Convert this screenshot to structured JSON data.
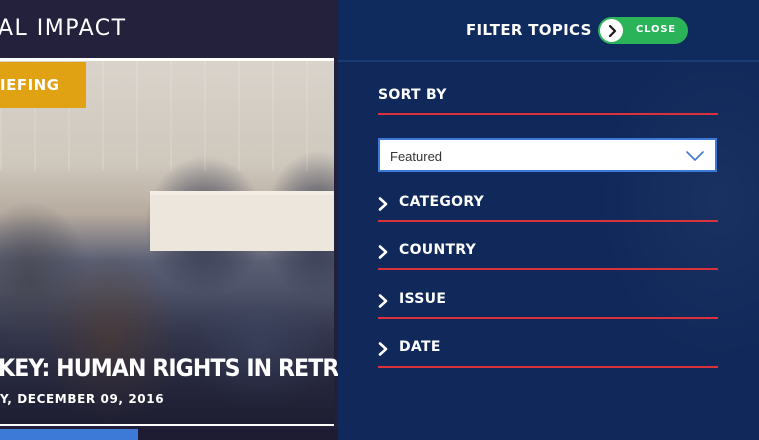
{
  "article": {
    "section_title": "AL IMPACT",
    "tag": "IEFING",
    "headline": "KEY: HUMAN RIGHTS IN RETREAT",
    "date": "Y, DECEMBER 09, 2016"
  },
  "filter_panel": {
    "title": "FILTER TOPICS",
    "close_label": "CLOSE",
    "sort_by_label": "SORT BY",
    "sort_value": "Featured",
    "items": [
      {
        "label": "CATEGORY"
      },
      {
        "label": "COUNTRY"
      },
      {
        "label": "ISSUE"
      },
      {
        "label": "DATE"
      }
    ]
  },
  "colors": {
    "panel_bg": "#10295a",
    "accent_red": "#d9323a",
    "toggle_green": "#2bb35a",
    "tag_yellow": "#e0a113",
    "select_border": "#3d7ad8"
  },
  "icons": {
    "toggle_knob": "chevron-right-icon",
    "accordion": "chevron-right-icon",
    "select": "chevron-down-icon"
  }
}
